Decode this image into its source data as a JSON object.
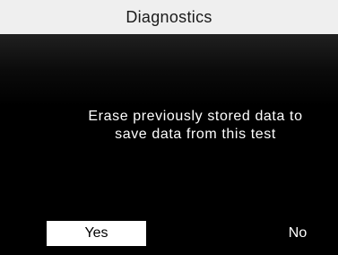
{
  "header": {
    "title": "Diagnostics"
  },
  "dialog": {
    "message_line1": "Erase previously stored data to",
    "message_line2": "save data from this test"
  },
  "buttons": {
    "yes_label": "Yes",
    "no_label": "No",
    "selected": "Yes"
  },
  "colors": {
    "title_bar_bg": "#efefef",
    "screen_bg": "#000000",
    "selected_button_bg": "#ffffff",
    "text_on_dark": "#ffffff"
  }
}
